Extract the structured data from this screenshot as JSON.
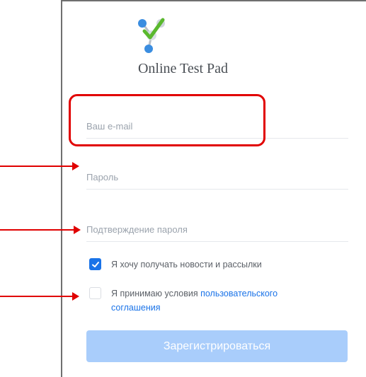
{
  "brand": {
    "name": "Online Test Pad",
    "logo_icon": "molecule-check-logo-icon"
  },
  "form": {
    "email_placeholder": "Ваш e-mail",
    "password_placeholder": "Пароль",
    "confirm_placeholder": "Подтверждение пароля",
    "newsletter": {
      "label": "Я хочу получать новости и рассылки",
      "checked": true
    },
    "terms": {
      "label_prefix": "Я принимаю условия ",
      "link_text": "пользовательского соглашения",
      "checked": false
    },
    "submit_label": "Зарегистрироваться"
  },
  "colors": {
    "accent": "#1a73e8",
    "button_disabled": "#a9cdfb",
    "annotation_red": "#e10000"
  }
}
